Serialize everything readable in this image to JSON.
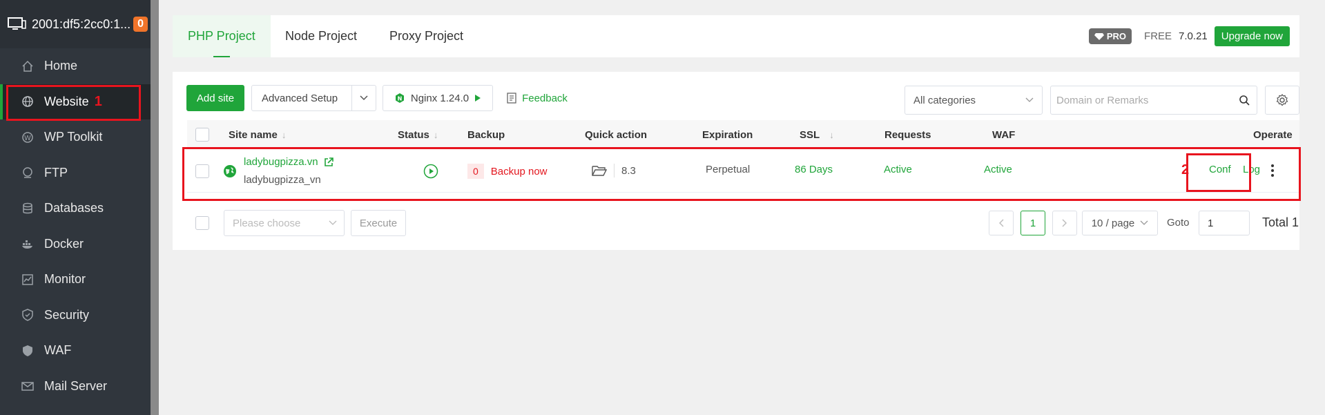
{
  "server": {
    "label": "2001:df5:2cc0:1...",
    "badge": "0"
  },
  "sidebar": {
    "items": [
      {
        "label": "Home",
        "icon": "home-icon"
      },
      {
        "label": "Website",
        "icon": "globe-icon",
        "annotation": "1"
      },
      {
        "label": "WP Toolkit",
        "icon": "wordpress-icon"
      },
      {
        "label": "FTP",
        "icon": "ftp-icon"
      },
      {
        "label": "Databases",
        "icon": "database-icon"
      },
      {
        "label": "Docker",
        "icon": "docker-icon"
      },
      {
        "label": "Monitor",
        "icon": "monitor-chart-icon"
      },
      {
        "label": "Security",
        "icon": "shield-icon"
      },
      {
        "label": "WAF",
        "icon": "waf-shield-icon"
      },
      {
        "label": "Mail Server",
        "icon": "mail-icon"
      }
    ]
  },
  "tabs": [
    "PHP Project",
    "Node Project",
    "Proxy Project"
  ],
  "top_right": {
    "pro": "PRO",
    "free": "FREE",
    "version": "7.0.21",
    "upgrade": "Upgrade now"
  },
  "toolbar": {
    "add_site": "Add site",
    "advanced_setup": "Advanced Setup",
    "nginx": "Nginx 1.24.0",
    "feedback": "Feedback",
    "category": "All categories",
    "search_placeholder": "Domain or Remarks"
  },
  "table": {
    "headers": [
      "Site name",
      "Status",
      "Backup",
      "Quick action",
      "Expiration",
      "SSL",
      "Requests",
      "WAF",
      "Operate"
    ],
    "rows": [
      {
        "site_name": "ladybugpizza.vn",
        "remark": "ladybugpizza_vn",
        "backup_count": "0",
        "backup_action": "Backup now",
        "php_version": "8.3",
        "expiration": "Perpetual",
        "ssl": "86 Days",
        "requests": "Active",
        "waf": "Active",
        "annotation": "2",
        "conf": "Conf",
        "log": "Log"
      }
    ]
  },
  "footer": {
    "bulk_placeholder": "Please choose",
    "execute": "Execute",
    "page": "1",
    "per_page": "10 / page",
    "goto_label": "Goto",
    "goto_value": "1",
    "total": "Total 1"
  },
  "colors": {
    "accent": "#20a53a",
    "annotation": "#e8141e",
    "sidebar": "#30363d"
  }
}
